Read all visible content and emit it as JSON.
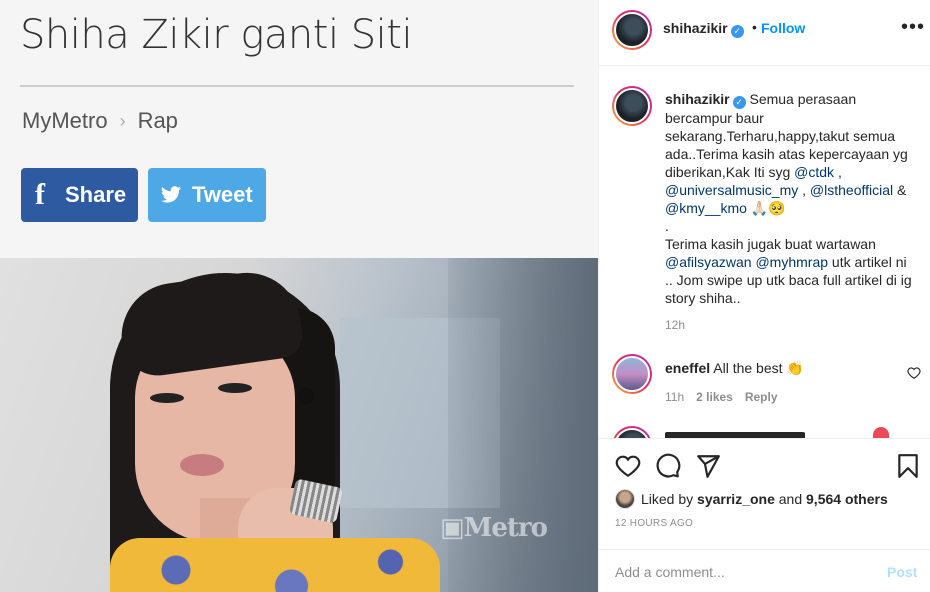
{
  "article": {
    "headline": "Shiha Zikir ganti Siti",
    "breadcrumb": {
      "section": "MyMetro",
      "separator": "›",
      "subsection": "Rap"
    },
    "share_label": "Share",
    "share_icon": "f",
    "tweet_label": "Tweet",
    "watermark": "▣Metro",
    "colors": {
      "share": "#2d5aa0",
      "tweet": "#4fa8e6"
    }
  },
  "post": {
    "username": "shihazikir",
    "follow_label": "Follow",
    "dot": "•",
    "more_icon": "•••"
  },
  "caption": {
    "username": "shihazikir",
    "text_1": "Semua perasaan bercampur baur sekarang.Terharu,happy,takut semua ada..Terima kasih atas kepercayaan yg diberikan,Kak Iti syg ",
    "mention_1": "@ctdk",
    "sep_1": " , ",
    "mention_2": "@universalmusic_my",
    "sep_2": " , ",
    "mention_3": "@lstheofficial",
    "sep_3": " & ",
    "mention_4": "@kmy__kmo",
    "emoji_1": " 🙏🏻🥺",
    "dot_line": ".",
    "text_2": "Terima kasih jugak buat wartawan ",
    "mention_5": "@afilsyazwan",
    "sep_4": " ",
    "mention_6": "@myhmrap",
    "text_3": " utk artikel ni .. Jom swipe up utk baca full artikel di ig story shiha..",
    "time": "12h"
  },
  "comment": {
    "username": "eneffel",
    "text": "All the best 👏",
    "time": "11h",
    "likes": "2 likes",
    "reply_label": "Reply"
  },
  "actions": {
    "liked_by_prefix": "Liked by ",
    "liked_by_user": "syarriz_one",
    "liked_by_mid": " and ",
    "liked_by_count": "9,564 others",
    "timestamp": "12 HOURS AGO"
  },
  "add_comment": {
    "placeholder": "Add a comment...",
    "post_label": "Post"
  }
}
